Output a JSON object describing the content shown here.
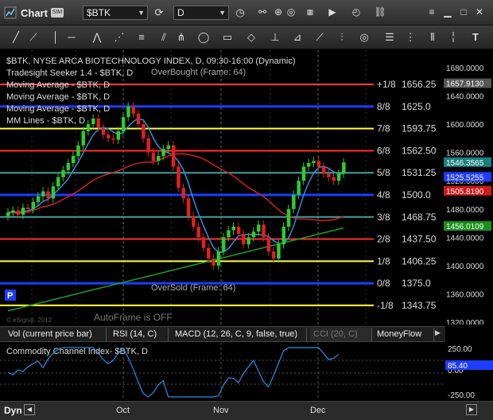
{
  "window": {
    "title": "Chart",
    "symbol": "$BTK",
    "interval": "D"
  },
  "chart_legend": {
    "line1": "$BTK, NYSE ARCA BIOTECHNOLOGY INDEX, D, 09:30-16:00 (Dynamic)",
    "line2": "Tradesight Seeker 1.4 - $BTK, D",
    "line3": "Moving Average - $BTK, D",
    "line4": "Moving Average - $BTK, D",
    "line5": "Moving Average - $BTK, D",
    "line6": "MM Lines - $BTK, D"
  },
  "annotations": {
    "overbought": "OverBought (Frame: 64)",
    "oversold": "OverSold (Frame: 64)",
    "autoframe": "AutoFrame is OFF",
    "copyright": "© eSignal, 2012"
  },
  "mm_lines": [
    {
      "label": "+1/8",
      "value": "1656.25",
      "color": "#ff4040"
    },
    {
      "label": "8/8",
      "value": "1625.0",
      "color": "#1e3cff"
    },
    {
      "label": "7/8",
      "value": "1593.75",
      "color": "#ffff40"
    },
    {
      "label": "6/8",
      "value": "1562.50",
      "color": "#ff3030"
    },
    {
      "label": "5/8",
      "value": "1531.25",
      "color": "#40a0a0"
    },
    {
      "label": "4/8",
      "value": "1500.0",
      "color": "#1e3cff"
    },
    {
      "label": "3/8",
      "value": "1468.75",
      "color": "#40a0a0"
    },
    {
      "label": "2/8",
      "value": "1437.50",
      "color": "#ff3030"
    },
    {
      "label": "1/8",
      "value": "1406.25",
      "color": "#ffff40"
    },
    {
      "label": "0/8",
      "value": "1375.0",
      "color": "#1e3cff"
    },
    {
      "label": "-1/8",
      "value": "1343.75",
      "color": "#ffff40"
    }
  ],
  "price_axis": {
    "ticks": [
      "1680.0000",
      "1640.0000",
      "1600.0000",
      "1560.0000",
      "1520.0000",
      "1480.0000",
      "1440.0000",
      "1400.0000",
      "1360.0000",
      "1320.0000"
    ],
    "badges": [
      {
        "text": "1657.9130",
        "bg": "#555555"
      },
      {
        "text": "1546.3565",
        "bg": "#1a7f7f"
      },
      {
        "text": "1525.5255",
        "bg": "#1e3cff"
      },
      {
        "text": "1505.8190",
        "bg": "#cc1a1a"
      },
      {
        "text": "1456.0109",
        "bg": "#1a8f1a"
      }
    ]
  },
  "date_axis": [
    "Oct",
    "Nov",
    "Dec"
  ],
  "study_tabs": [
    {
      "label": "Vol (current price bar)"
    },
    {
      "label": "RSI (14, C)"
    },
    {
      "label": "MACD (12, 26, C, 9, false, true)"
    },
    {
      "label": "CCI (20, C)"
    },
    {
      "label": "MoneyFlow"
    }
  ],
  "cci_panel": {
    "title": "Commodity Channel Index- $BTK, D",
    "axis": [
      "250.00",
      "0.00",
      "-250.00"
    ],
    "badge": "85.40",
    "badge_color": "#1e3cff"
  },
  "bottom_bar": {
    "dyn": "Dyn"
  },
  "colors": {
    "up_candle": "#2ecc2e",
    "down_candle": "#e02020",
    "fast_ma": "#2a8fe0",
    "mid_ma": "#d02020",
    "slow_ma": "#20a020"
  }
}
